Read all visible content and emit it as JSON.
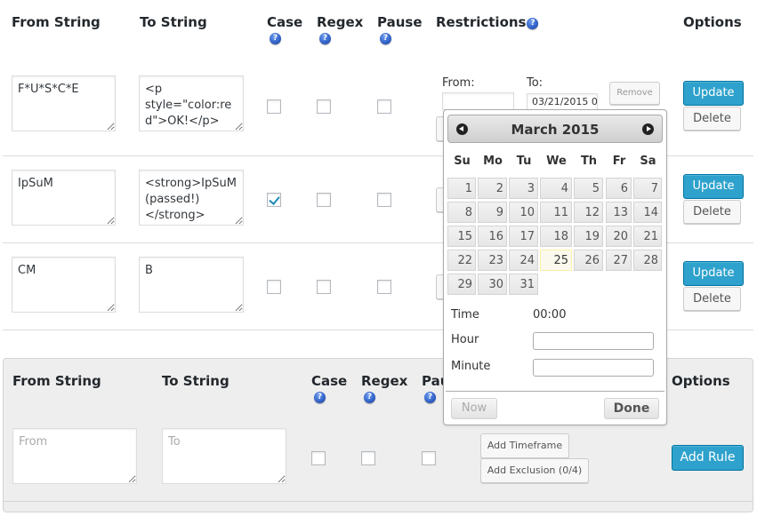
{
  "headers": {
    "from_string": "From String",
    "to_string": "To String",
    "case": "Case",
    "regex": "Regex",
    "pause": "Pause",
    "restrictions": "Restrictions",
    "options": "Options",
    "help_glyph": "?"
  },
  "rules": [
    {
      "from": "F*U*S*C*E",
      "to": "<p style=\"color:red\">OK!</p>",
      "case": false,
      "regex": false,
      "pause": false,
      "restriction": {
        "from_label": "From:",
        "to_label": "To:",
        "from_value": "",
        "to_value": "03/21/2015 0",
        "remove_label": "Remove"
      },
      "update_label": "Update",
      "delete_label": "Delete"
    },
    {
      "from": "IpSuM",
      "to": "<strong>IpSuM(passed!)</strong>",
      "case": true,
      "regex": false,
      "pause": false,
      "update_label": "Update",
      "delete_label": "Delete"
    },
    {
      "from": "CM",
      "to": "B",
      "case": false,
      "regex": false,
      "pause": false,
      "update_label": "Update",
      "delete_label": "Delete"
    }
  ],
  "add_rule": {
    "from_placeholder": "From",
    "to_placeholder": "To",
    "case": false,
    "regex": false,
    "pause": false,
    "add_timeframe_label": "Add Timeframe",
    "add_exclusion_label": "Add Exclusion (0/4)",
    "add_rule_label": "Add Rule"
  },
  "datepicker": {
    "title": "March 2015",
    "weekdays": [
      "Su",
      "Mo",
      "Tu",
      "We",
      "Th",
      "Fr",
      "Sa"
    ],
    "first_weekday_index": 0,
    "days_in_month": 31,
    "today": 25,
    "time_label": "Time",
    "time_value": "00:00",
    "hour_label": "Hour",
    "minute_label": "Minute",
    "now_label": "Now",
    "done_label": "Done"
  },
  "colors": {
    "primary_button": "#2ea2cc",
    "help_icon": "#2f5fc5",
    "checkbox_check": "#1e8cbe",
    "today_highlight": "#fbf9ee"
  }
}
